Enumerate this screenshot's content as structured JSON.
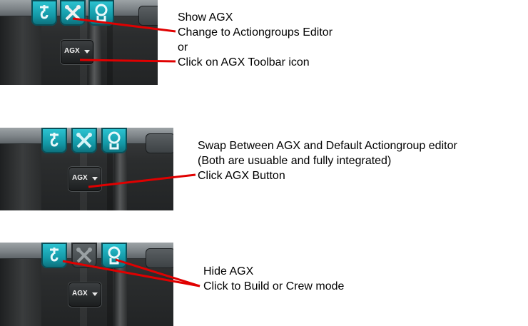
{
  "panels": [
    {
      "agx_button_label": "AGX",
      "active_tab": "editor",
      "tabs": [
        "crane-hook-icon",
        "tools-icon",
        "kerbal-icon"
      ],
      "note": [
        "Show AGX",
        "Change to Actiongroups Editor",
        "or",
        "Click on AGX Toolbar icon"
      ]
    },
    {
      "agx_button_label": "AGX",
      "active_tab": "all",
      "tabs": [
        "crane-hook-icon",
        "tools-icon",
        "kerbal-icon"
      ],
      "note": [
        "Swap Between AGX and Default Actiongroup editor",
        "(Both are usuable and fully integrated)",
        "Click AGX Button"
      ]
    },
    {
      "agx_button_label": "AGX",
      "active_tab": "build-crew",
      "tabs": [
        "crane-hook-icon",
        "tools-icon",
        "kerbal-icon"
      ],
      "note": [
        "Hide AGX",
        "Click to Build or Crew mode"
      ]
    }
  ],
  "colors": {
    "accent": "#1bb3c2",
    "arrow_line": "#e00000"
  }
}
